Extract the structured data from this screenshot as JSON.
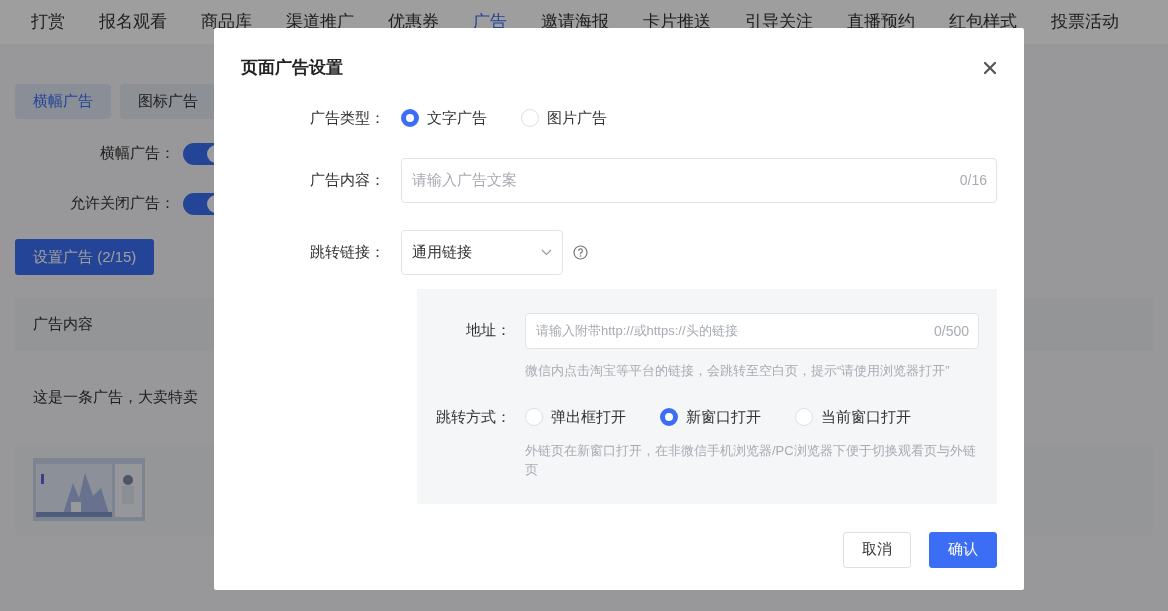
{
  "nav": [
    {
      "label": "打赏",
      "selected": false
    },
    {
      "label": "报名观看",
      "selected": false
    },
    {
      "label": "商品库",
      "selected": false
    },
    {
      "label": "渠道推广",
      "selected": false
    },
    {
      "label": "优惠券",
      "selected": false
    },
    {
      "label": "广告",
      "selected": true
    },
    {
      "label": "邀请海报",
      "selected": false
    },
    {
      "label": "卡片推送",
      "selected": false
    },
    {
      "label": "引导关注",
      "selected": false
    },
    {
      "label": "直播预约",
      "selected": false
    },
    {
      "label": "红包样式",
      "selected": false
    },
    {
      "label": "投票活动",
      "selected": false
    }
  ],
  "sub_tabs": [
    {
      "label": "横幅广告",
      "selected": true
    },
    {
      "label": "图标广告",
      "selected": false
    }
  ],
  "switches": [
    {
      "label": "横幅广告：",
      "on": true
    },
    {
      "label": "允许关闭广告：",
      "on": true
    }
  ],
  "set_button": "设置广告 (2/15)",
  "table": {
    "columns": [
      "广告内容"
    ],
    "rows": [
      {
        "kind": "text",
        "text": "这是一条广告，大卖特卖"
      },
      {
        "kind": "picture"
      }
    ]
  },
  "dialog": {
    "title": "页面广告设置",
    "ad_type": {
      "label": "广告类型：",
      "options": [
        {
          "label": "文字广告",
          "selected": true
        },
        {
          "label": "图片广告",
          "selected": false
        }
      ]
    },
    "content": {
      "label": "广告内容：",
      "placeholder": "请输入广告文案",
      "counter": "0/16"
    },
    "link": {
      "label": "跳转链接：",
      "value": "通用链接"
    },
    "address": {
      "label": "地址：",
      "placeholder": "请输入附带http://或https://头的链接",
      "counter": "0/500",
      "hint": "微信内点击淘宝等平台的链接，会跳转至空白页，提示“请使用浏览器打开”"
    },
    "open_mode": {
      "label": "跳转方式：",
      "options": [
        {
          "label": "弹出框打开",
          "selected": false
        },
        {
          "label": "新窗口打开",
          "selected": true
        },
        {
          "label": "当前窗口打开",
          "selected": false
        }
      ],
      "hint": "外链页在新窗口打开，在非微信手机浏览器/PC浏览器下便于切换观看页与外链页"
    },
    "buttons": [
      {
        "label": "取消",
        "kind": "secondary"
      },
      {
        "label": "确认",
        "kind": "primary"
      }
    ]
  }
}
